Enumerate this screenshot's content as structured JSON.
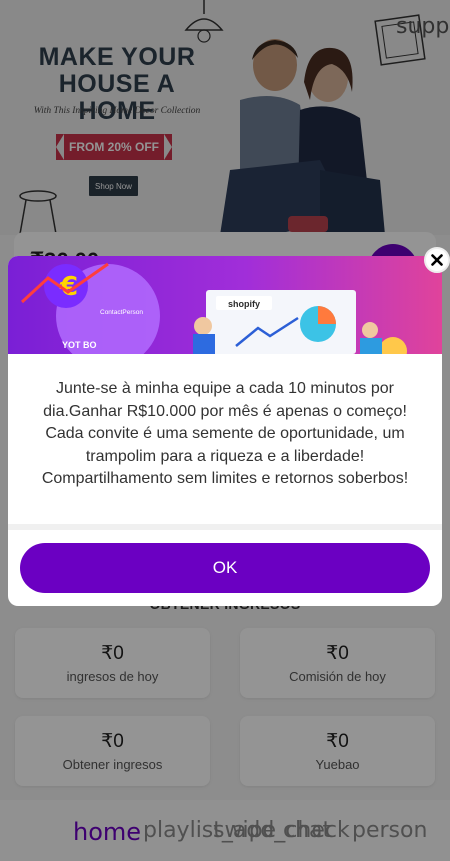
{
  "hero": {
    "title_line1": "MAKE YOUR",
    "title_line2": "HOUSE A HOME",
    "subtitle": "With This Inspiring Home Decor Collection",
    "badge": "FROM 20% OFF",
    "shop_label": "Shop Now",
    "corner_label": "supp"
  },
  "balance": {
    "amount": "₹36.00"
  },
  "income": {
    "section_title": "OBTENER INGRESOS",
    "cards": [
      {
        "value": "₹0",
        "label": "ingresos de hoy"
      },
      {
        "value": "₹0",
        "label": "Comisión de hoy"
      },
      {
        "value": "₹0",
        "label": "Obtener ingresos"
      },
      {
        "value": "₹0",
        "label": "Yuebao"
      }
    ]
  },
  "bottom_nav": {
    "items": [
      "home",
      "playlist_add_check",
      "swipe",
      "chat",
      "person"
    ],
    "active": "home"
  },
  "dialog": {
    "banner_label": "shopify",
    "banner_side_label": "ContactPerson",
    "banner_corner_label": "YOT BO",
    "message": "Junte-se à minha equipe a cada 10 minutos por dia.Ganhar R$10.000 por mês é apenas o começo! Cada convite é uma semente de oportunidade, um trampolim para a riqueza e a liberdade! Compartilhamento sem limites e retornos soberbos!",
    "ok_label": "OK"
  },
  "colors": {
    "accent": "#6b00c2",
    "badge_red": "#c9334a",
    "banner_gradient": [
      "#7a1fd6",
      "#e0439b"
    ]
  }
}
